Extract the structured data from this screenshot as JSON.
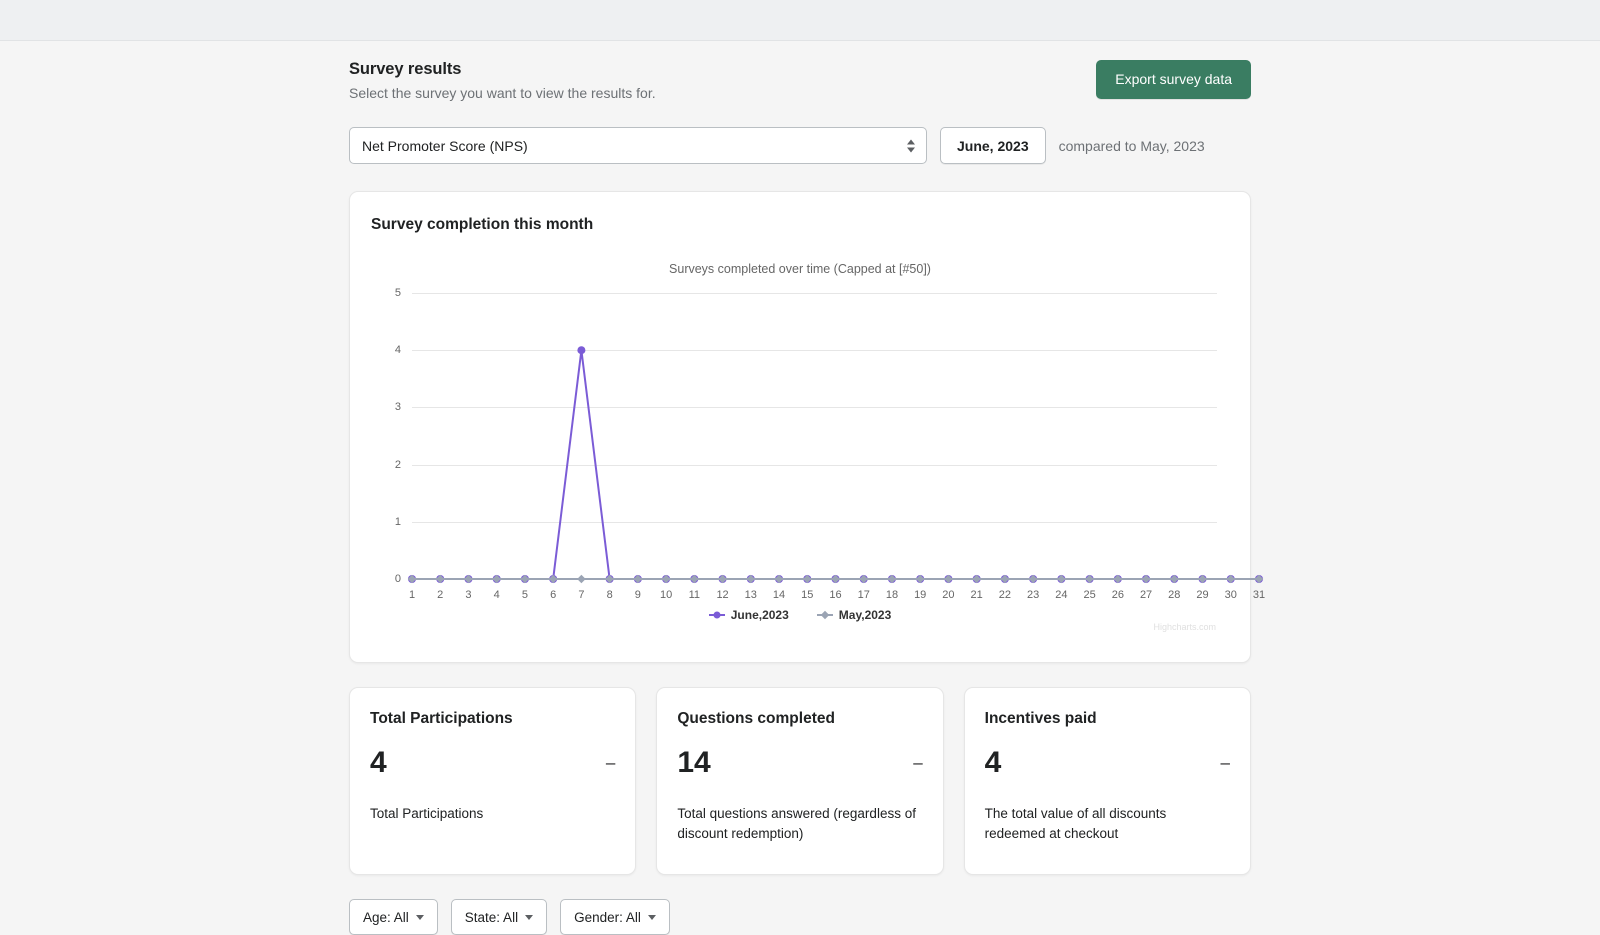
{
  "header": {
    "title": "Survey results",
    "subtitle": "Select the survey you want to view the results for.",
    "export_label": "Export survey data"
  },
  "controls": {
    "survey_selected": "Net Promoter Score (NPS)",
    "month_label": "June, 2023",
    "compare_label": "compared to May, 2023"
  },
  "chart_card": {
    "title": "Survey completion this month",
    "credits": "Highcharts.com"
  },
  "chart_data": {
    "type": "line",
    "title": "",
    "subtitle": "Surveys completed over time (Capped at [#50])",
    "xlabel": "",
    "ylabel": "",
    "categories": [
      "1",
      "2",
      "3",
      "4",
      "5",
      "6",
      "7",
      "8",
      "9",
      "10",
      "11",
      "12",
      "13",
      "14",
      "15",
      "16",
      "17",
      "18",
      "19",
      "20",
      "21",
      "22",
      "23",
      "24",
      "25",
      "26",
      "27",
      "28",
      "29",
      "30",
      "31"
    ],
    "yticks": [
      "0",
      "1",
      "2",
      "3",
      "4",
      "5"
    ],
    "ylim": [
      0,
      5
    ],
    "grid": true,
    "legend_position": "bottom",
    "series": [
      {
        "name": "June,2023",
        "color": "#7b5cd6",
        "marker": "circle",
        "values": [
          0,
          0,
          0,
          0,
          0,
          0,
          4,
          0,
          0,
          0,
          0,
          0,
          0,
          0,
          0,
          0,
          0,
          0,
          0,
          0,
          0,
          0,
          0,
          0,
          0,
          0,
          0,
          0,
          0,
          0,
          0
        ]
      },
      {
        "name": "May,2023",
        "color": "#9ba4b4",
        "marker": "diamond",
        "values": [
          0,
          0,
          0,
          0,
          0,
          0,
          0,
          0,
          0,
          0,
          0,
          0,
          0,
          0,
          0,
          0,
          0,
          0,
          0,
          0,
          0,
          0,
          0,
          0,
          0,
          0,
          0,
          0,
          0,
          0,
          0
        ]
      }
    ]
  },
  "stats": [
    {
      "title": "Total Participations",
      "value": "4",
      "delta": "–",
      "description": "Total Participations"
    },
    {
      "title": "Questions completed",
      "value": "14",
      "delta": "–",
      "description": "Total questions answered (regardless of discount redemption)"
    },
    {
      "title": "Incentives paid",
      "value": "4",
      "delta": "–",
      "description": "The total value of all discounts redeemed at checkout"
    }
  ],
  "filters": [
    {
      "label": "Age: All"
    },
    {
      "label": "State: All"
    },
    {
      "label": "Gender: All"
    }
  ]
}
